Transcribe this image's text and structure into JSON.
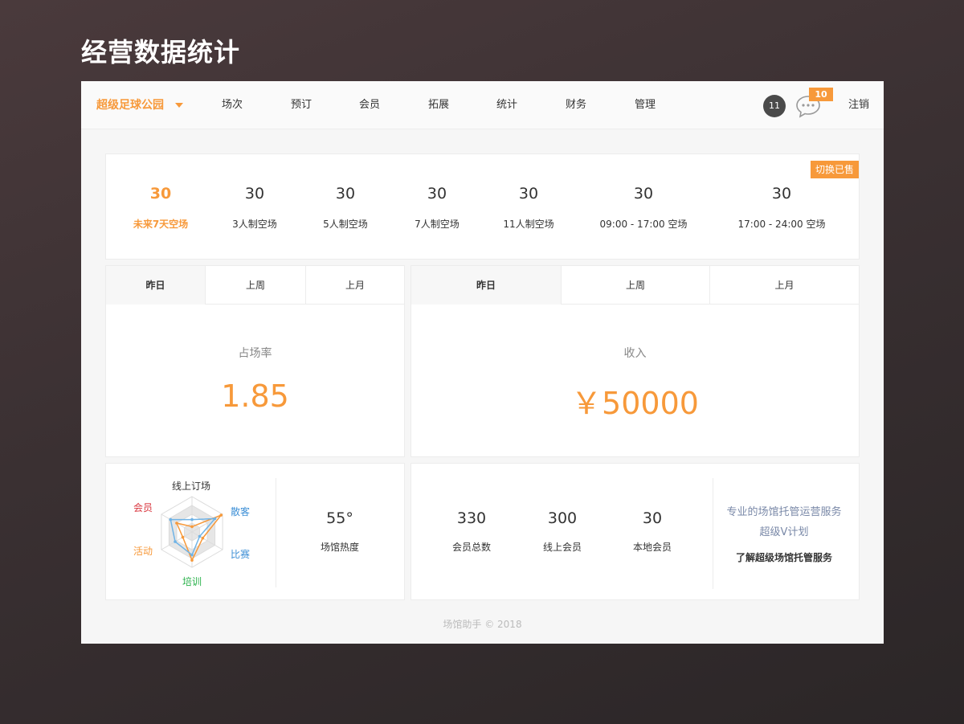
{
  "slide_title": "经营数据统计",
  "navbar": {
    "venue": "超级足球公园",
    "items": [
      "场次",
      "预订",
      "会员",
      "拓展",
      "统计",
      "财务",
      "管理"
    ],
    "notif_count": "11",
    "message_count": "10",
    "logout": "注销"
  },
  "stats": {
    "switch_label": "切换已售",
    "items": [
      {
        "value": "30",
        "label": "未来7天空场"
      },
      {
        "value": "30",
        "label": "3人制空场"
      },
      {
        "value": "30",
        "label": "5人制空场"
      },
      {
        "value": "30",
        "label": "7人制空场"
      },
      {
        "value": "30",
        "label": "11人制空场"
      },
      {
        "value": "30",
        "label": "09:00 - 17:00 空场"
      },
      {
        "value": "30",
        "label": "17:00 - 24:00 空场"
      }
    ]
  },
  "occupancy": {
    "tabs": [
      "昨日",
      "上周",
      "上月"
    ],
    "title": "占场率",
    "value": "1.85"
  },
  "revenue": {
    "tabs": [
      "昨日",
      "上周",
      "上月"
    ],
    "title": "收入",
    "value": "￥50000"
  },
  "radar": {
    "labels": {
      "top": "线上订场",
      "top_right": "散客",
      "bottom_right": "比赛",
      "bottom": "培训",
      "bottom_left": "活动",
      "top_left": "会员"
    },
    "colors": {
      "top": "#333333",
      "top_right": "#3d8fd6",
      "bottom_right": "#3d8fd6",
      "bottom": "#2bb24c",
      "bottom_left": "#f7993a",
      "top_left": "#d9363e"
    },
    "series": [
      {
        "color": "#f7993a",
        "values": [
          0.15,
          0.95,
          0.35,
          0.8,
          0.3,
          0.5
        ]
      },
      {
        "color": "#6fb3e6",
        "values": [
          0.35,
          0.75,
          0.25,
          0.65,
          0.55,
          0.7
        ]
      }
    ]
  },
  "heat": {
    "value": "55°",
    "label": "场馆热度"
  },
  "members": {
    "items": [
      {
        "value": "330",
        "label": "会员总数"
      },
      {
        "value": "300",
        "label": "线上会员"
      },
      {
        "value": "30",
        "label": "本地会员"
      }
    ]
  },
  "promo": {
    "line1": "专业的场馆托管运营服务",
    "line2": "超级V计划",
    "link": "了解超级场馆托管服务"
  },
  "footer": "场馆助手 © 2018",
  "colors": {
    "accent": "#f7993a",
    "text": "#333333",
    "muted": "#888888"
  }
}
